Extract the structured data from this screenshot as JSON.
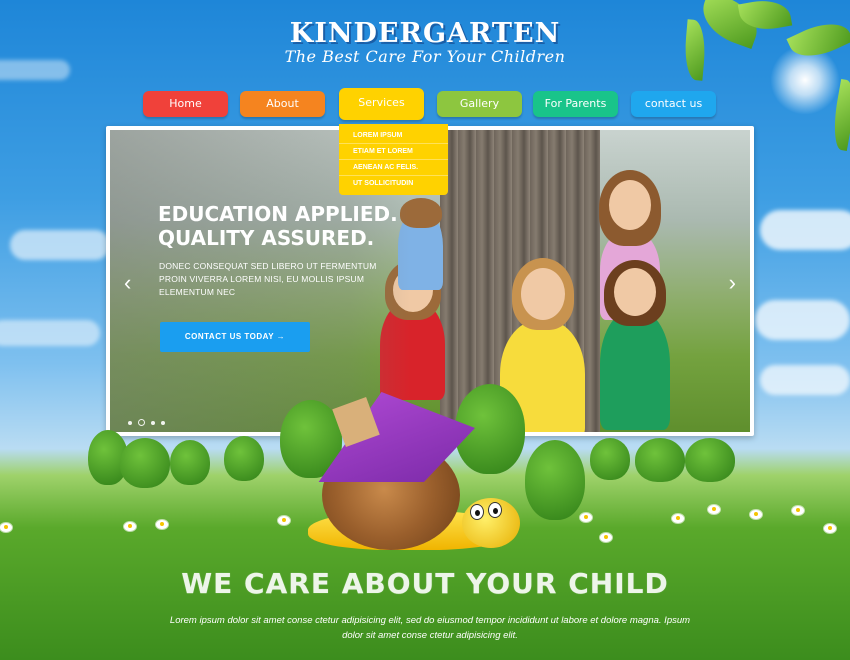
{
  "logo": {
    "title": "KINDERGARTEN",
    "tagline": "The Best Care For Your Children"
  },
  "nav": {
    "items": [
      {
        "label": "Home",
        "color": "#f0413a"
      },
      {
        "label": "About",
        "color": "#f5841f"
      },
      {
        "label": "Services",
        "color": "#ffd200"
      },
      {
        "label": "Gallery",
        "color": "#8dc63f"
      },
      {
        "label": "For Parents",
        "color": "#19c48a"
      },
      {
        "label": "contact us",
        "color": "#1fa7ee"
      }
    ],
    "dropdown": [
      "LOREM IPSUM",
      "ETIAM ET LOREM",
      "AENEAN AC FELIS.",
      "UT SOLLICITUDIN"
    ]
  },
  "slider": {
    "headline": "EDUCATION APPLIED. QUALITY ASSURED.",
    "subtext": "DONEC CONSEQUAT SED LIBERO UT FERMENTUM PROIN VIVERRA LOREM NISI, EU MOLLIS IPSUM ELEMENTUM NEC",
    "cta_label": "CONTACT US TODAY  →",
    "prev_icon": "‹",
    "next_icon": "›",
    "slide_count": 4,
    "active_slide": 2
  },
  "section": {
    "title": "WE CARE ABOUT YOUR CHILD",
    "text": "Lorem ipsum dolor sit amet conse ctetur adipisicing elit, sed do eiusmod tempor incididunt ut labore et dolore magna. Ipsum dolor sit amet conse ctetur adipisicing elit."
  }
}
